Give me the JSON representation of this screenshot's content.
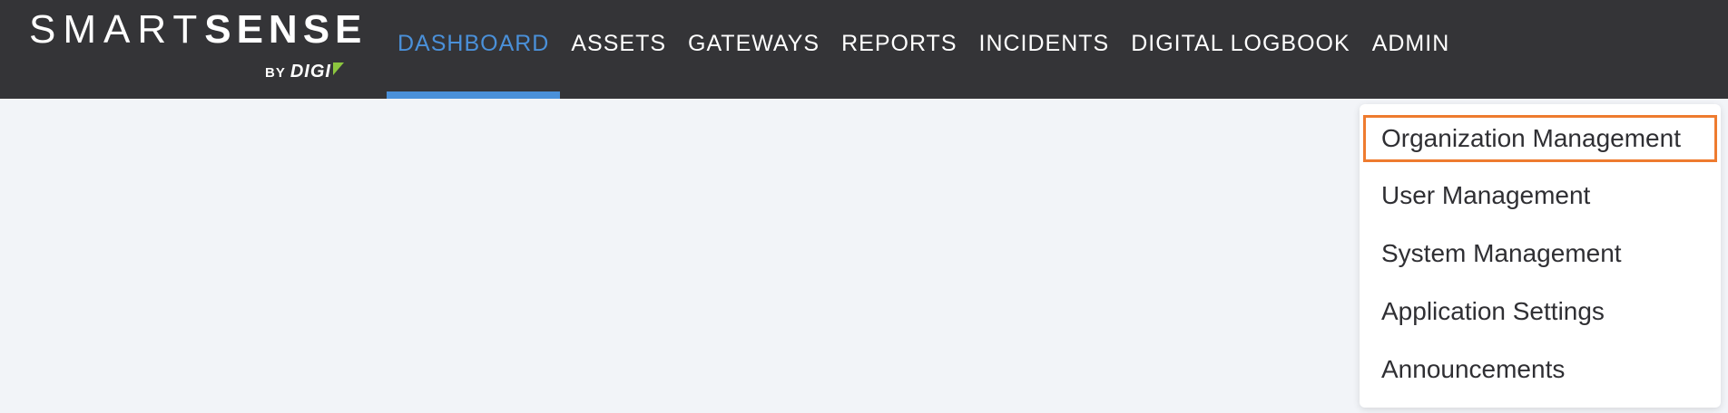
{
  "brand": {
    "smart": "SMART",
    "sense": "SENSE",
    "by": "BY",
    "company": "DIGI",
    "accent_color": "#8cc63f"
  },
  "nav": {
    "active_color": "#4a90d9",
    "items": [
      {
        "label": "DASHBOARD",
        "active": true
      },
      {
        "label": "ASSETS"
      },
      {
        "label": "GATEWAYS"
      },
      {
        "label": "REPORTS"
      },
      {
        "label": "INCIDENTS"
      },
      {
        "label": "DIGITAL LOGBOOK"
      },
      {
        "label": "ADMIN"
      }
    ]
  },
  "admin_menu": {
    "highlight_color": "#ee7b2f",
    "items": [
      {
        "label": "Organization Management"
      },
      {
        "label": "User Management"
      },
      {
        "label": "System Management"
      },
      {
        "label": "Application Settings"
      },
      {
        "label": "Announcements"
      }
    ]
  }
}
